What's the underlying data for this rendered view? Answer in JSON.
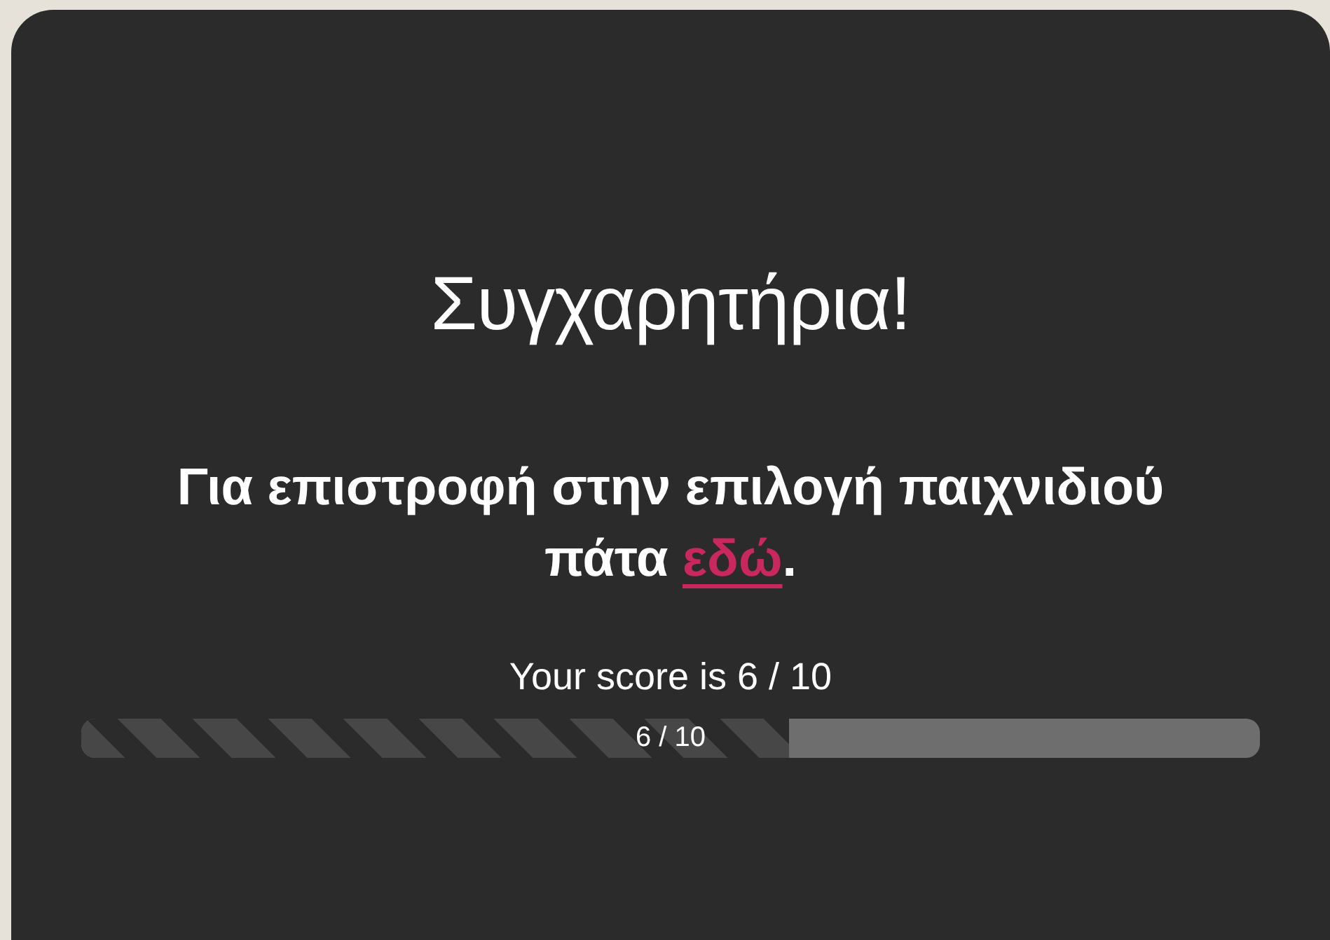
{
  "title": "Συγχαρητήρια!",
  "message": {
    "text": "Για επιστροφή στην επιλογή παιχνιδιού πάτα",
    "link": "εδώ",
    "end": "."
  },
  "score": {
    "text": "Your score is 6 / 10",
    "label": "6 / 10",
    "level": 0.6
  }
}
